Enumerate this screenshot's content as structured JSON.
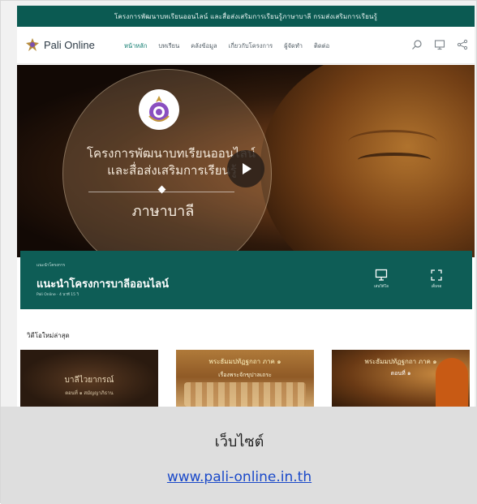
{
  "topbar": {
    "text": "โครงการพัฒนาบทเรียนออนไลน์ และสื่อส่งเสริมการเรียนรู้ภาษาบาลี กรมส่งเสริมการเรียนรู้"
  },
  "header": {
    "logo_text": "Pali Online",
    "nav": [
      "หน้าหลัก",
      "บทเรียน",
      "คลังข้อมูล",
      "เกี่ยวกับโครงการ",
      "ผู้จัดทำ",
      "ติดต่อ"
    ],
    "icons": [
      "search-icon",
      "monitor-icon",
      "share-icon"
    ]
  },
  "hero": {
    "line1": "โครงการพัฒนาบทเรียนออนไลน์",
    "line2": "และสื่อส่งเสริมการเรียนรู้",
    "title": "ภาษาบาลี"
  },
  "banner": {
    "kicker": "แนะนำโครงการ",
    "title": "แนะนำโครงการบาลีออนไลน์",
    "meta": "Pali Online · 4 นาที 15 วิ",
    "actions": [
      {
        "label": "เล่นวิดีโอ",
        "icon": "monitor-icon"
      },
      {
        "label": "เต็มจอ",
        "icon": "fullscreen-icon"
      }
    ]
  },
  "section": {
    "title": "วิดีโอใหม่ล่าสุด"
  },
  "thumbnails": [
    {
      "line1": "บาลีไวยากรณ์",
      "line2": "ตอนที่ ๑ สมัญญาภิธาน"
    },
    {
      "line1": "พระธัมมปทัฏฐกถา ภาค ๑",
      "line2": "เรื่องพระจักขุปาลเถระ"
    },
    {
      "line1": "พระธัมมปทัฏฐกถา ภาค ๑",
      "line2": "ตอนที่ ๑"
    }
  ],
  "caption": {
    "label": "เว็บไซต์",
    "link": "www.pali-online.in.th"
  },
  "colors": {
    "brand_green": "#0b5a52",
    "banner_green": "#0e5d56",
    "link_blue": "#1a49c9",
    "caption_bg": "#dedede"
  }
}
